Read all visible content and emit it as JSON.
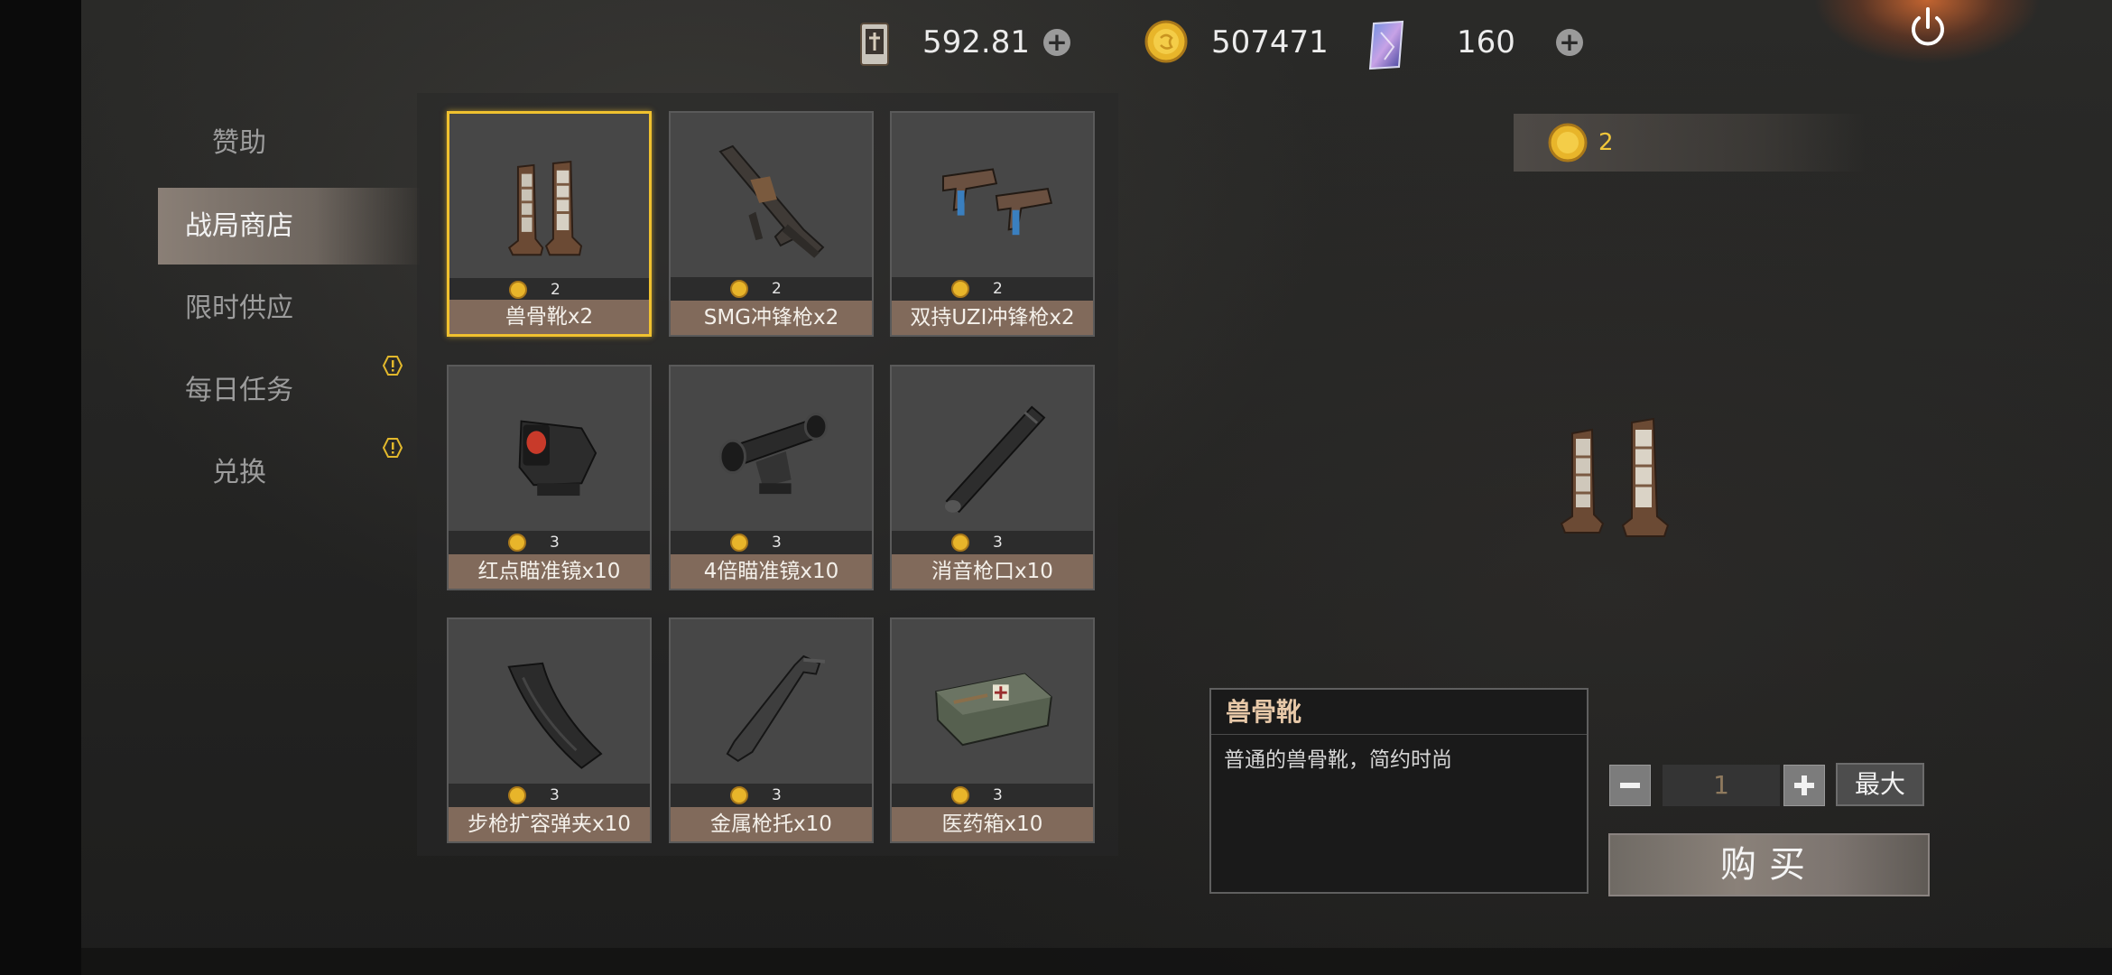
{
  "currency": {
    "ticket_value": "592.81",
    "coin_value": "507471",
    "card_value": "160"
  },
  "sidebar": {
    "items": [
      {
        "label": "赞助"
      },
      {
        "label": "战局商店"
      },
      {
        "label": "限时供应"
      },
      {
        "label": "每日任务"
      },
      {
        "label": "兑换"
      }
    ]
  },
  "shop": {
    "items": [
      {
        "name": "兽骨靴x2",
        "price": "2",
        "icon": "boots-icon"
      },
      {
        "name": "SMG冲锋枪x2",
        "price": "2",
        "icon": "smg-icon"
      },
      {
        "name": "双持UZI冲锋枪x2",
        "price": "2",
        "icon": "uzi-icon"
      },
      {
        "name": "红点瞄准镜x10",
        "price": "3",
        "icon": "red-dot-sight-icon"
      },
      {
        "name": "4倍瞄准镜x10",
        "price": "3",
        "icon": "scope-4x-icon"
      },
      {
        "name": "消音枪口x10",
        "price": "3",
        "icon": "silencer-icon"
      },
      {
        "name": "步枪扩容弹夹x10",
        "price": "3",
        "icon": "magazine-icon"
      },
      {
        "name": "金属枪托x10",
        "price": "3",
        "icon": "stock-icon"
      },
      {
        "name": "医药箱x10",
        "price": "3",
        "icon": "medkit-icon"
      }
    ]
  },
  "detail": {
    "price": "2",
    "title": "兽骨靴",
    "description": "普通的兽骨靴，简约时尚",
    "quantity": "1",
    "max_label": "最大",
    "buy_label": "购买"
  },
  "colors": {
    "selected_border": "#f0c12f",
    "coin": "#e8b52a",
    "name_bar": "#816a5b"
  }
}
